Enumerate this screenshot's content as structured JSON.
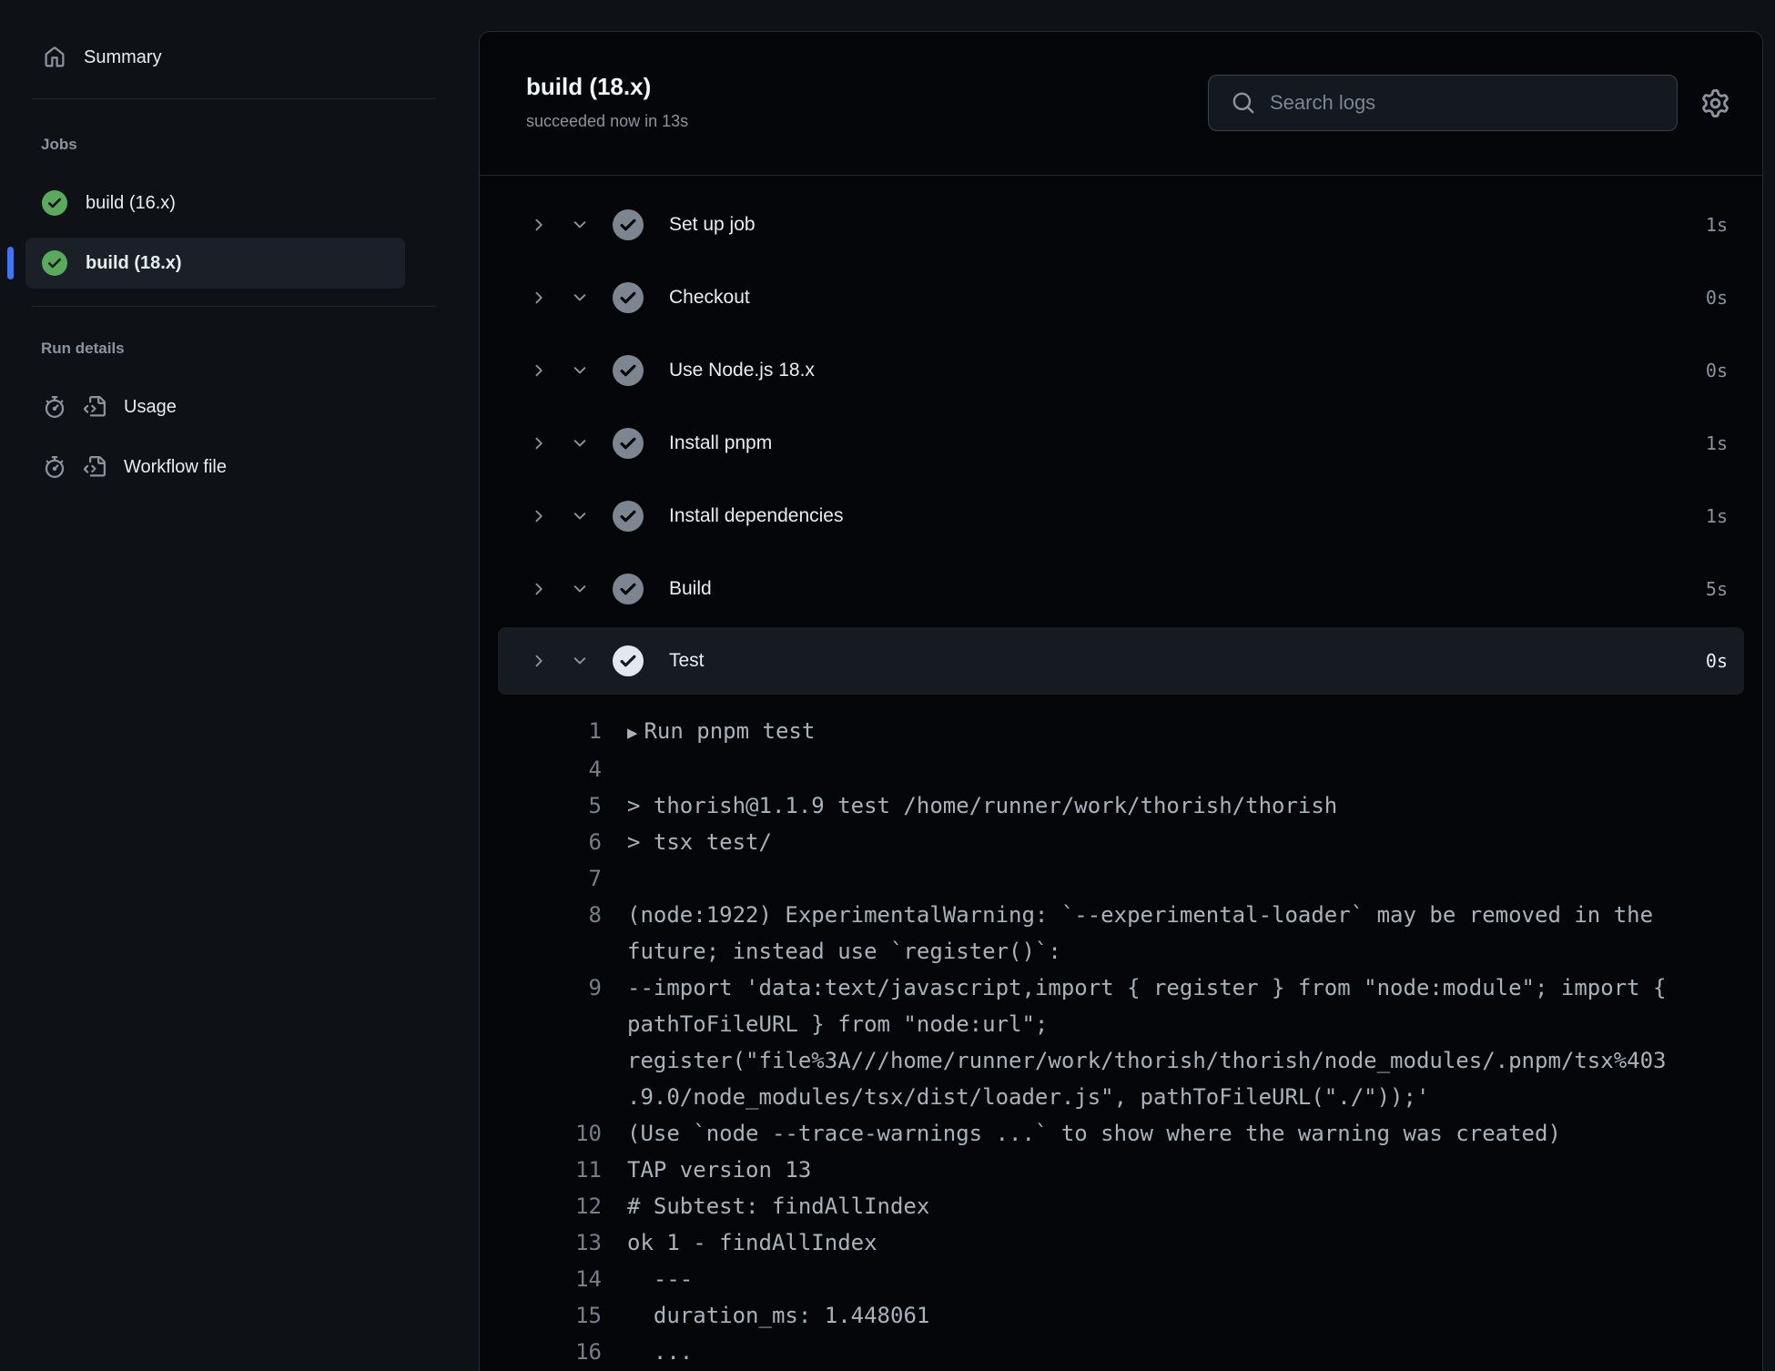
{
  "sidebar": {
    "summary_label": "Summary",
    "jobs_header": "Jobs",
    "jobs": [
      {
        "label": "build (16.x)",
        "status": "success",
        "selected": false
      },
      {
        "label": "build (18.x)",
        "status": "success",
        "selected": true
      }
    ],
    "run_details_header": "Run details",
    "run_details": [
      {
        "label": "Usage",
        "icon": "stopwatch-icon"
      },
      {
        "label": "Workflow file",
        "icon": "code-file-icon"
      }
    ]
  },
  "header": {
    "title": "build (18.x)",
    "status_line": "succeeded now in 13s",
    "search_placeholder": "Search logs"
  },
  "steps": [
    {
      "label": "Set up job",
      "duration": "1s",
      "status": "success",
      "expanded": false
    },
    {
      "label": "Checkout",
      "duration": "0s",
      "status": "success",
      "expanded": false
    },
    {
      "label": "Use Node.js 18.x",
      "duration": "0s",
      "status": "success",
      "expanded": false
    },
    {
      "label": "Install pnpm",
      "duration": "1s",
      "status": "success",
      "expanded": false
    },
    {
      "label": "Install dependencies",
      "duration": "1s",
      "status": "success",
      "expanded": false
    },
    {
      "label": "Build",
      "duration": "5s",
      "status": "success",
      "expanded": false
    },
    {
      "label": "Test",
      "duration": "0s",
      "status": "success",
      "expanded": true
    }
  ],
  "log": {
    "lines": [
      {
        "n": "1",
        "group": true,
        "text": "Run pnpm test"
      },
      {
        "n": "4",
        "group": false,
        "text": ""
      },
      {
        "n": "5",
        "group": false,
        "text": "> thorish@1.1.9 test /home/runner/work/thorish/thorish"
      },
      {
        "n": "6",
        "group": false,
        "text": "> tsx test/"
      },
      {
        "n": "7",
        "group": false,
        "text": ""
      },
      {
        "n": "8",
        "group": false,
        "text": "(node:1922) ExperimentalWarning: `--experimental-loader` may be removed in the future; instead use `register()`:"
      },
      {
        "n": "9",
        "group": false,
        "text": "--import 'data:text/javascript,import { register } from \"node:module\"; import { pathToFileURL } from \"node:url\"; register(\"file%3A///home/runner/work/thorish/thorish/node_modules/.pnpm/tsx%403.9.0/node_modules/tsx/dist/loader.js\", pathToFileURL(\"./\"));'"
      },
      {
        "n": "10",
        "group": false,
        "text": "(Use `node --trace-warnings ...` to show where the warning was created)"
      },
      {
        "n": "11",
        "group": false,
        "text": "TAP version 13"
      },
      {
        "n": "12",
        "group": false,
        "text": "# Subtest: findAllIndex"
      },
      {
        "n": "13",
        "group": false,
        "text": "ok 1 - findAllIndex"
      },
      {
        "n": "14",
        "group": false,
        "text": "  ---"
      },
      {
        "n": "15",
        "group": false,
        "text": "  duration_ms: 1.448061"
      },
      {
        "n": "16",
        "group": false,
        "text": "  ..."
      }
    ]
  },
  "colors": {
    "page-bg": "#0e1116",
    "card-bg": "#04060a",
    "card-border": "#252b33",
    "divider": "#21262d",
    "text-primary": "#e6edf3",
    "text-secondary": "#8b949e",
    "accent-blue": "#3d76f0",
    "success-green": "#57ab5a",
    "step-circle": "#7d8590",
    "expanded-circle": "#e3e8ee",
    "row-selected-bg": "#1b2028",
    "step-expanded-bg": "#161b22",
    "search-bg": "#14181f",
    "search-border": "#3a4049",
    "log-number": "#767f89",
    "log-text": "#a9b2bb"
  }
}
